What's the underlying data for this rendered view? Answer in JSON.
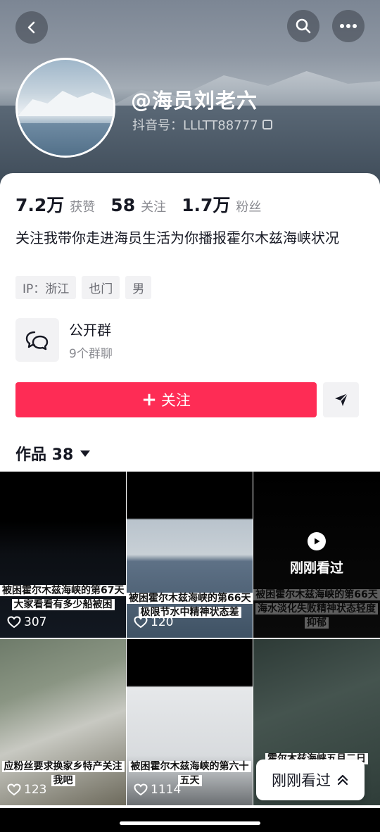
{
  "profile": {
    "nickname": "@海员刘老六",
    "douyin_id": "抖音号：LLLTT88777",
    "bio": "关注我带你走进海员生活为你播报霍尔木兹海峡状况",
    "tags": [
      "IP：浙江",
      "也门",
      "男"
    ]
  },
  "stats": [
    {
      "value": "7.2万",
      "label": "获赞"
    },
    {
      "value": "58",
      "label": "关注"
    },
    {
      "value": "1.7万",
      "label": "粉丝"
    }
  ],
  "group": {
    "title": "公开群",
    "subtitle": "9个群聊"
  },
  "actions": {
    "follow_label": "关注"
  },
  "works": {
    "label": "作品 38"
  },
  "videos": [
    {
      "caption": "被困霍尔木兹海峡的第67天大家看看有多少船被困",
      "likes": "307"
    },
    {
      "caption": "被困霍尔木兹海峡的第66天极限节水中精神状态差",
      "likes": "120"
    },
    {
      "caption": "被困霍尔木兹海峡的第66天海水淡化失败精神状态轻度抑郁",
      "likes": "",
      "overlay": "刚刚看过"
    },
    {
      "caption": "应粉丝要求换家乡特产关注我吧",
      "likes": "123"
    },
    {
      "caption": "被困霍尔木兹海峡的第六十五天",
      "likes": "1114"
    },
    {
      "caption": "霍尔木兹海峡五月二日",
      "likes": ""
    }
  ],
  "float_button": {
    "label": "刚刚看过"
  },
  "colors": {
    "accent": "#fe2c55"
  }
}
